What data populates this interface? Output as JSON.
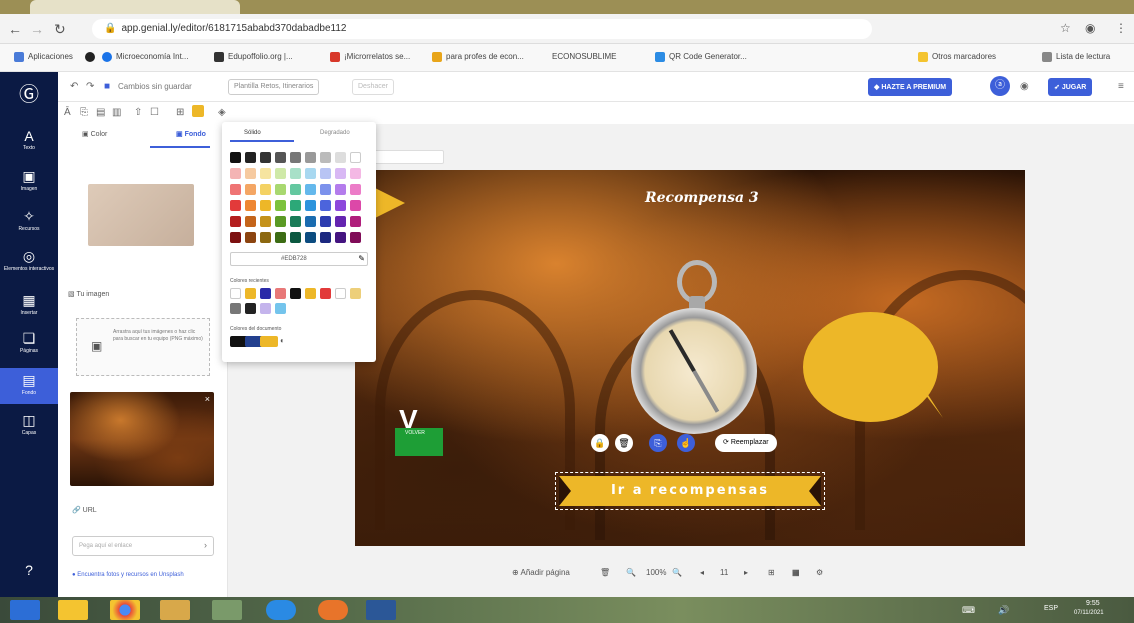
{
  "browser": {
    "url": "app.genial.ly/editor/6181715ababd370dabadbe112",
    "bookmarks": [
      "Aplicaciones",
      "Microeconomía Int...",
      "Edupoffolio.org |...",
      "¡Microrrelatos se...",
      "para profes de econ...",
      "ECONOSUBLIME",
      "QR Code Generator...",
      "Otros marcadores",
      "Lista de lectura"
    ]
  },
  "toolbar": {
    "saved_status": "Cambios sin guardar",
    "template_name": "Plantilla Retos, Itinerarios",
    "extra_pill": "Deshacer",
    "premium_label": "HAZTE A PREMIUM",
    "play_label": "JUGAR"
  },
  "rail": {
    "items": [
      {
        "icon": "text-icon",
        "glyph": "A",
        "label": "Texto"
      },
      {
        "icon": "image-icon",
        "glyph": "▣",
        "label": "Imagen"
      },
      {
        "icon": "resources-icon",
        "glyph": "✧",
        "label": "Recursos"
      },
      {
        "icon": "interactive-icon",
        "glyph": "◎",
        "label": "Elementos interactivos"
      },
      {
        "icon": "insert-icon",
        "glyph": "▦",
        "label": "Insertar"
      },
      {
        "icon": "pages-icon",
        "glyph": "❏",
        "label": "Páginas"
      },
      {
        "icon": "background-icon",
        "glyph": "▤",
        "label": "Fondo"
      },
      {
        "icon": "layers-icon",
        "glyph": "◫",
        "label": "Capas"
      }
    ],
    "help_glyph": "?"
  },
  "panel": {
    "tab_color": "Color",
    "tab_background": "Fondo",
    "upload_label": "Tu imagen",
    "drop_text": "Arrastra aquí tus imágenes o haz clic para buscar en tu equipo (PNG máximo)",
    "link_label": "URL",
    "link_placeholder": "Pega aquí el enlace",
    "help_text": "Encuentra fotos y recursos en Unsplash"
  },
  "picker": {
    "tab_solid": "Sólido",
    "tab_gradient": "Degradado",
    "hex_value": "#EDB728",
    "recent_label": "Colores recientes",
    "document_label": "Colores del documento",
    "colors": {
      "grid_rows": [
        [
          "#111111",
          "#222222",
          "#333333",
          "#555555",
          "#777777",
          "#999999",
          "#bbbbbb",
          "#dddddd",
          "#ffffff"
        ],
        [
          "#f4b4b4",
          "#f6caa0",
          "#f6e4a0",
          "#cfe9a8",
          "#a8e0c8",
          "#a8d8f0",
          "#b8c4f4",
          "#d8b8f4",
          "#f4b8e4"
        ],
        [
          "#ef7474",
          "#f4a664",
          "#f4d264",
          "#a8d870",
          "#64c8a0",
          "#64b8ec",
          "#7c92ec",
          "#b47cec",
          "#ec7cc8"
        ],
        [
          "#e23a3a",
          "#ee8632",
          "#edb728",
          "#7cc23c",
          "#2ca878",
          "#2c94dc",
          "#4c64dc",
          "#8c48dc",
          "#dc48a8"
        ],
        [
          "#b41e1e",
          "#c4641a",
          "#c4921a",
          "#5a9a24",
          "#1a7c58",
          "#1a6cb0",
          "#2c3cb0",
          "#6424b0",
          "#b01e7c"
        ],
        [
          "#7c1010",
          "#8c4410",
          "#8c6810",
          "#3c6c14",
          "#0c5840",
          "#0c4c80",
          "#1c2880",
          "#441480",
          "#800c58"
        ]
      ],
      "recent": [
        "#ffffff",
        "#edb728",
        "#2a2aa8",
        "#e87878",
        "#111111",
        "#edb728",
        "#e23a3a",
        "#ffffff",
        "#edcf7a",
        "#777777",
        "#222222",
        "#c4b4ec",
        "#74c4ec"
      ],
      "document": [
        "#111111",
        "#23408e",
        "#edb728"
      ]
    }
  },
  "canvas": {
    "reward_title": "Recompensa 3",
    "button_text": "Ir a recompensas",
    "replace_label": "Reemplazar",
    "badge_text": "VOLVER",
    "colors": {
      "accent": "#edb728",
      "green": "#1e9e36"
    }
  },
  "bottom": {
    "add_page": "Añadir página",
    "zoom": "100%",
    "page_num": "11"
  },
  "taskbar": {
    "lang": "ESP",
    "time": "9:55",
    "date": "07/11/2021"
  }
}
